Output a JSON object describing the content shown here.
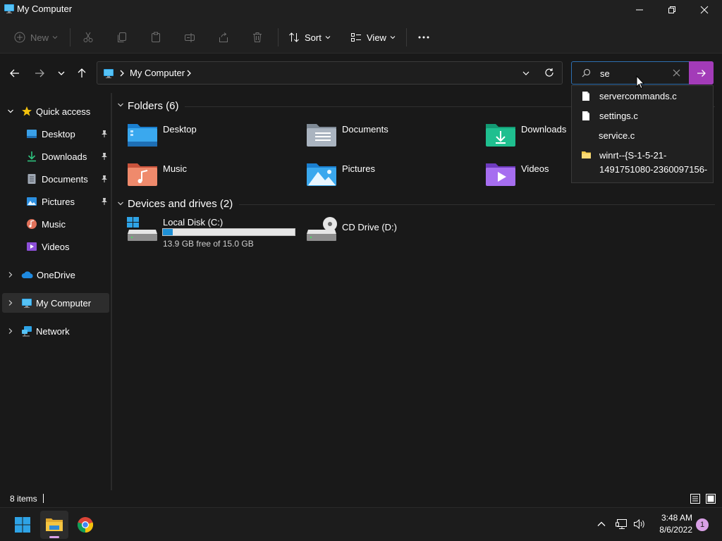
{
  "window": {
    "title": "My Computer"
  },
  "toolbar": {
    "new_label": "New",
    "sort_label": "Sort",
    "view_label": "View"
  },
  "address": {
    "path_label": "My Computer"
  },
  "search": {
    "value": "se"
  },
  "sidebar": {
    "items": [
      {
        "label": "Quick access",
        "icon": "star-icon"
      },
      {
        "label": "Desktop",
        "icon": "desktop-icon",
        "pinned": true
      },
      {
        "label": "Downloads",
        "icon": "download-icon",
        "pinned": true
      },
      {
        "label": "Documents",
        "icon": "document-icon",
        "pinned": true
      },
      {
        "label": "Pictures",
        "icon": "pictures-icon",
        "pinned": true
      },
      {
        "label": "Music",
        "icon": "music-icon"
      },
      {
        "label": "Videos",
        "icon": "videos-icon"
      },
      {
        "label": "OneDrive",
        "icon": "cloud-icon"
      },
      {
        "label": "My Computer",
        "icon": "computer-icon",
        "selected": true
      },
      {
        "label": "Network",
        "icon": "network-icon"
      }
    ]
  },
  "content": {
    "folders_heading": "Folders (6)",
    "folders": [
      {
        "label": "Desktop"
      },
      {
        "label": "Documents"
      },
      {
        "label": "Downloads"
      },
      {
        "label": "Music"
      },
      {
        "label": "Pictures"
      },
      {
        "label": "Videos"
      }
    ],
    "drives_heading": "Devices and drives (2)",
    "drives": [
      {
        "label": "Local Disk (C:)",
        "free_text": "13.9 GB free of 15.0 GB",
        "used_fraction": 0.073
      },
      {
        "label": "CD Drive (D:)"
      }
    ]
  },
  "suggestions": [
    {
      "label": "servercommands.c",
      "icon": "file-icon"
    },
    {
      "label": "settings.c",
      "icon": "file-icon"
    },
    {
      "label": "service.c",
      "icon": "none"
    },
    {
      "label_line1": "winrt--{S-1-5-21-",
      "label_line2": "1491751080-2360097156-",
      "icon": "folder-icon"
    }
  ],
  "status": {
    "items_text": "8 items"
  },
  "taskbar": {
    "time": "3:48 AM",
    "date": "8/6/2022",
    "notification_count": "1"
  },
  "colors": {
    "accent": "#a33bb8",
    "drive_bar": "#1e90d6",
    "selection": "#2d2d2d"
  }
}
